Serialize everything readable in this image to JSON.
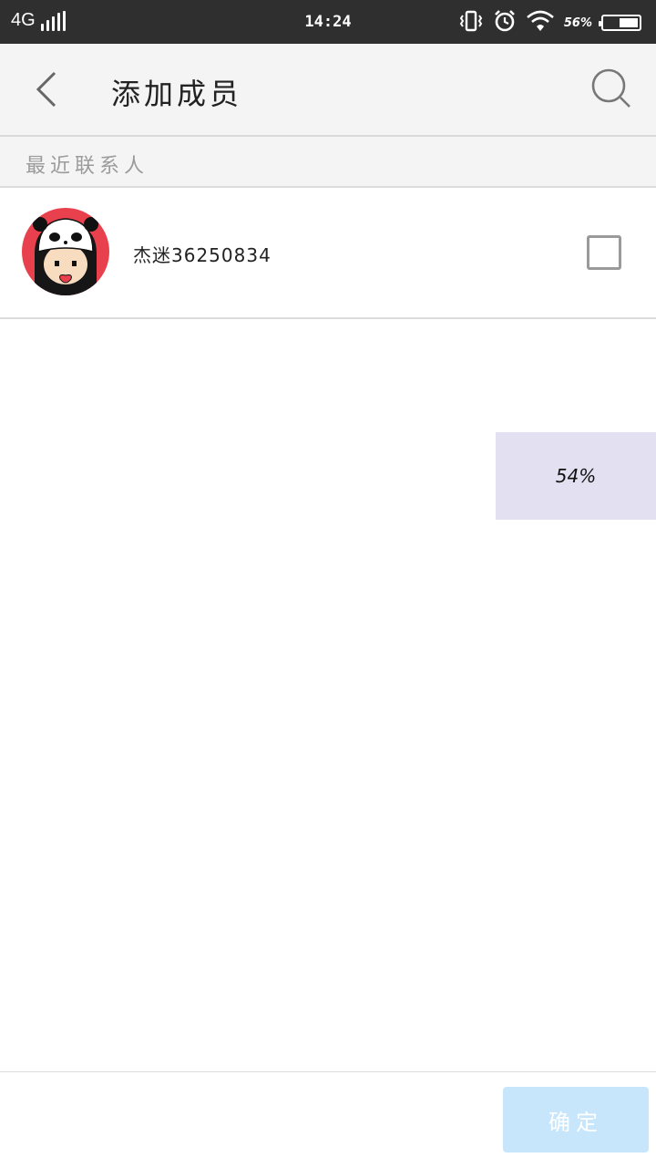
{
  "status_bar": {
    "network": "4G",
    "time": "14:24",
    "battery_percent": "56%",
    "battery_level": 0.56,
    "icons": [
      "signal-icon",
      "vibrate-icon",
      "alarm-icon",
      "wifi-icon",
      "battery-icon"
    ]
  },
  "header": {
    "title": "添加成员"
  },
  "section": {
    "title": "最近联系人"
  },
  "contacts": [
    {
      "name": "杰迷36250834",
      "checked": false
    }
  ],
  "progress_overlay": {
    "text": "54%"
  },
  "footer": {
    "confirm_label": "确定"
  },
  "colors": {
    "status_bar_bg": "#2f2f2f",
    "header_bg": "#f4f4f4",
    "overlay_bg": "#e3e0f1",
    "confirm_bg": "#c8e6fb"
  }
}
